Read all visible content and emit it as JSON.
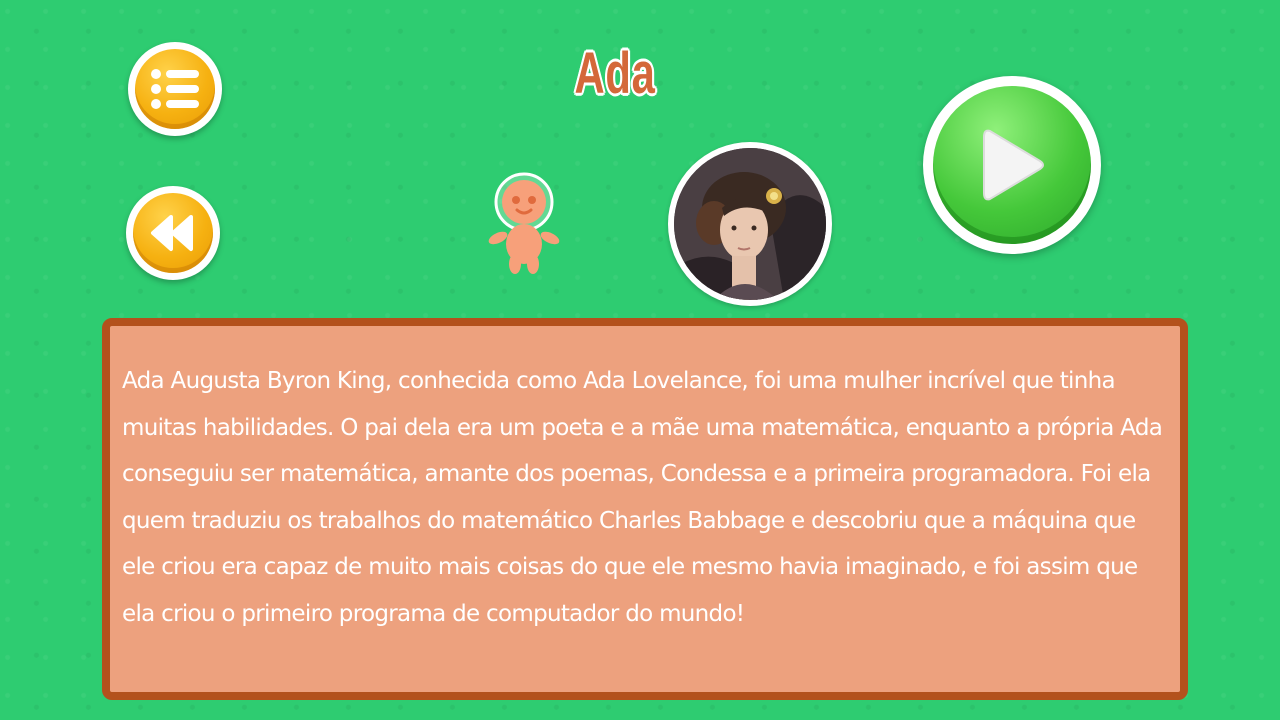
{
  "title": "Ada",
  "buttons": {
    "menu_icon": "list-icon",
    "back_icon": "rewind-icon",
    "play_icon": "play-icon"
  },
  "portrait": {
    "icon": "ada-lovelace-portrait"
  },
  "mascot": {
    "icon": "astronaut-mascot-icon"
  },
  "description": "Ada Augusta Byron King, conhecida como Ada Lovelance, foi uma mulher incrível que tinha muitas habilidades. O pai dela era um poeta e a mãe uma matemática, enquanto a própria Ada conseguiu ser matemática, amante dos poemas, Condessa e a primeira programadora. Foi ela quem traduziu os trabalhos do matemático Charles Babbage e descobriu que a máquina que ele criou era capaz de muito mais coisas do que ele mesmo havia imaginado, e foi assim que ela criou o primeiro programa de computador do mundo!",
  "colors": {
    "background": "#2ecc71",
    "title": "#d4683a",
    "panel": "#eda17e",
    "panel_border": "#b3511c",
    "button_orange": "#f6b111",
    "button_green": "#45c83a"
  }
}
